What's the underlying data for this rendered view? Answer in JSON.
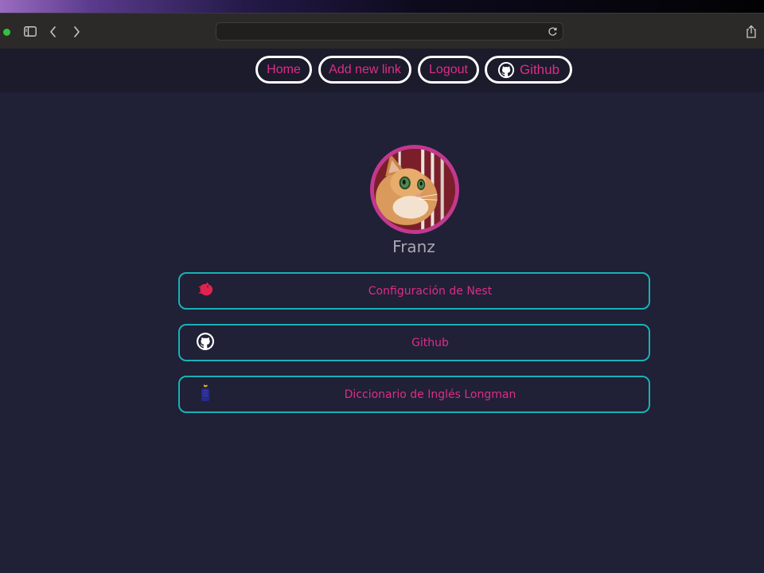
{
  "colors": {
    "page_background": "#202036",
    "nav_background": "#1b1b2c",
    "accent_pink": "#dd2d8a",
    "card_border_teal": "#17b2b6",
    "avatar_ring": "#c1398e"
  },
  "browser": {
    "address": ""
  },
  "nav": {
    "home": "Home",
    "add_new_link": "Add new link",
    "logout": "Logout",
    "github": "Github"
  },
  "profile": {
    "name": "Franz",
    "avatar_icon": "cat-avatar"
  },
  "links": [
    {
      "label": "Configuración de Nest",
      "icon": "nestjs-icon"
    },
    {
      "label": "Github",
      "icon": "github-icon"
    },
    {
      "label": "Diccionario de Inglés Longman",
      "icon": "longman-icon"
    }
  ]
}
